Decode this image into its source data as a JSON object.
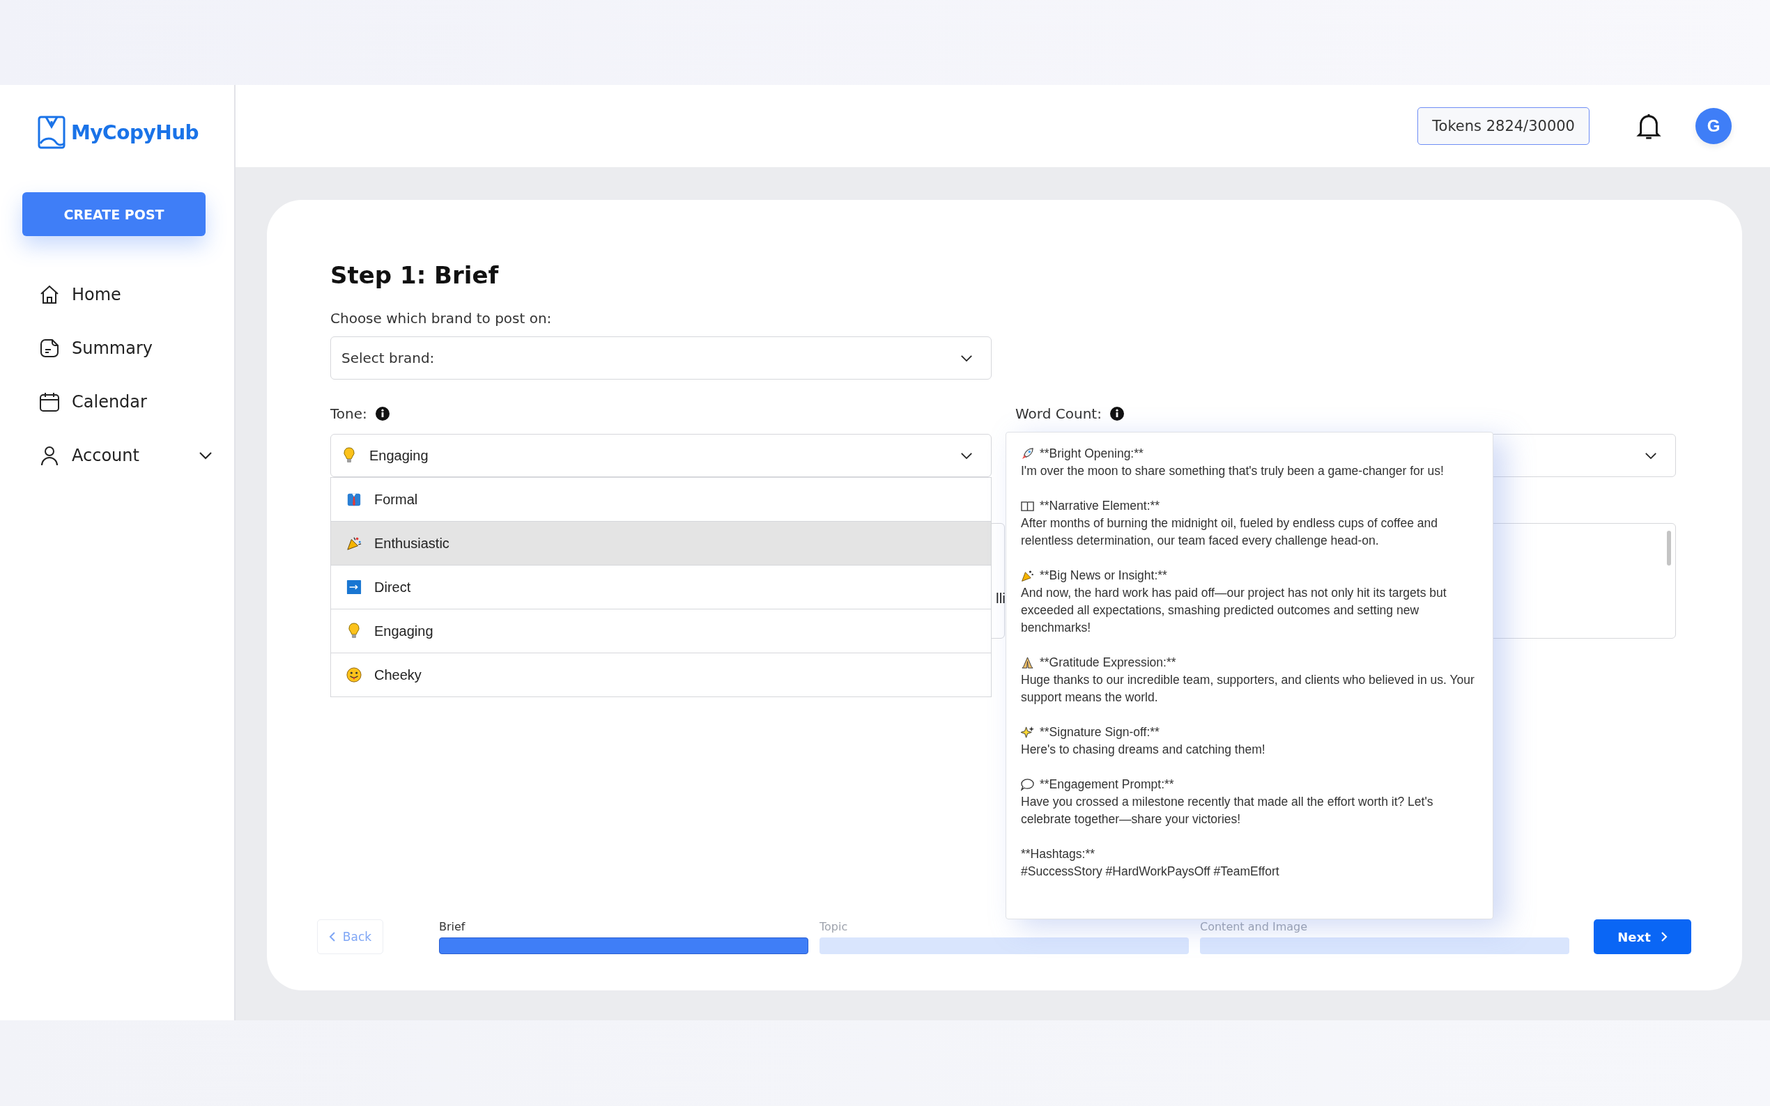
{
  "sidebar": {
    "logo": "MyCopyHub",
    "create_button": "CREATE POST",
    "nav": [
      {
        "label": "Home"
      },
      {
        "label": "Summary"
      },
      {
        "label": "Calendar"
      },
      {
        "label": "Account",
        "expanded": false
      }
    ]
  },
  "header": {
    "tokens": "Tokens 2824/30000",
    "avatar": "G"
  },
  "form": {
    "title": "Step 1: Brief",
    "brand_label": "Choose which brand to post on:",
    "brand_select": {
      "placeholder": "Select brand:"
    },
    "tone": {
      "label": "Tone:",
      "value": "Engaging",
      "options": [
        {
          "label": "Formal",
          "highlighted": false
        },
        {
          "label": "Enthusiastic",
          "highlighted": true
        },
        {
          "label": "Direct",
          "highlighted": false
        },
        {
          "label": "Engaging",
          "highlighted": false
        },
        {
          "label": "Cheeky",
          "highlighted": false
        }
      ]
    },
    "covered_field": {
      "value": "lli"
    },
    "word_count": {
      "label": "Word Count:"
    }
  },
  "preview": {
    "sections": [
      {
        "kind": "icon",
        "heading": "**Bright Opening:**",
        "body": "I'm over the moon to share something that's truly been a game-changer for us!"
      },
      {
        "kind": "icon",
        "heading": "**Narrative Element:**",
        "body": "After months of burning the midnight oil, fueled by endless cups of coffee and relentless determination, our team faced every challenge head-on."
      },
      {
        "kind": "icon",
        "heading": "**Big News or Insight:**",
        "body": "And now, the hard work has paid off—our project has not only hit its targets but exceeded all expectations, smashing predicted outcomes and setting new benchmarks!"
      },
      {
        "kind": "icon",
        "heading": "**Gratitude Expression:**",
        "body": "Huge thanks to our incredible team, supporters, and clients who believed in us. Your support means the world."
      },
      {
        "kind": "icon",
        "heading": "**Signature Sign-off:**",
        "body": "Here's to chasing dreams and catching them!"
      },
      {
        "kind": "icon",
        "heading": "**Engagement Prompt:**",
        "body": "Have you crossed a milestone recently that made all the effort worth it? Let's celebrate together—share your victories!"
      },
      {
        "kind": "plain",
        "heading": "**Hashtags:**",
        "body": "#SuccessStory #HardWorkPaysOff #TeamEffort"
      }
    ]
  },
  "footer": {
    "back": "Back",
    "steps": [
      {
        "label": "Brief",
        "active": true
      },
      {
        "label": "Topic",
        "active": false
      },
      {
        "label": "Content and Image",
        "active": false
      }
    ],
    "next": "Next"
  }
}
